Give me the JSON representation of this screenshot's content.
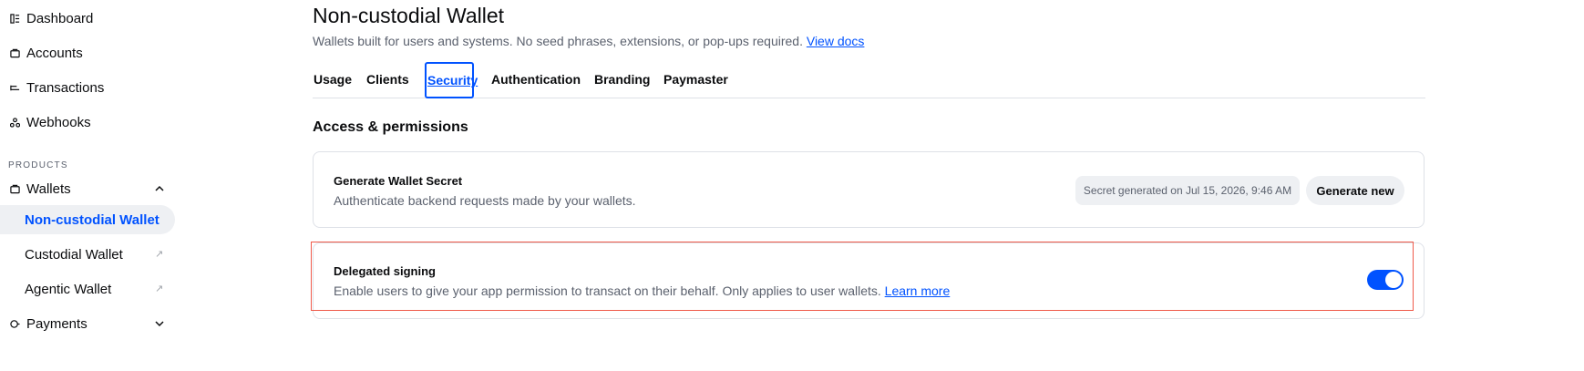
{
  "sidebar": {
    "items": [
      {
        "label": "Dashboard",
        "icon": "dashboard-icon"
      },
      {
        "label": "Accounts",
        "icon": "accounts-icon"
      },
      {
        "label": "Transactions",
        "icon": "transactions-icon"
      },
      {
        "label": "Webhooks",
        "icon": "webhooks-icon"
      }
    ],
    "products_label": "PRODUCTS",
    "wallets": {
      "label": "Wallets",
      "icon": "wallet-icon",
      "expanded": true,
      "children": [
        {
          "label": "Non-custodial Wallet",
          "active": true
        },
        {
          "label": "Custodial Wallet",
          "external": true
        },
        {
          "label": "Agentic Wallet",
          "external": true
        }
      ]
    },
    "payments": {
      "label": "Payments",
      "icon": "payments-icon",
      "expanded": false
    }
  },
  "header": {
    "title": "Non-custodial Wallet",
    "subtitle": "Wallets built for users and systems. No seed phrases, extensions, or pop-ups required.",
    "docs_link": "View docs"
  },
  "tabs": [
    "Usage",
    "Clients",
    "Security",
    "Authentication",
    "Branding",
    "Paymaster"
  ],
  "active_tab": "Security",
  "section": {
    "heading": "Access & permissions"
  },
  "wallet_secret": {
    "title": "Generate Wallet Secret",
    "description": "Authenticate backend requests made by your wallets.",
    "status": "Secret generated on Jul 15, 2026, 9:46 AM",
    "button": "Generate new"
  },
  "delegated_signing": {
    "title": "Delegated signing",
    "description": "Enable users to give your app permission to transact on their behalf. Only applies to user wallets.",
    "link": "Learn more",
    "enabled": true
  },
  "colors": {
    "accent": "#0052ff",
    "muted_text": "#5b616e",
    "surface": "#eef0f3",
    "border": "#dee1e7",
    "highlight": "#ef5a4a"
  }
}
